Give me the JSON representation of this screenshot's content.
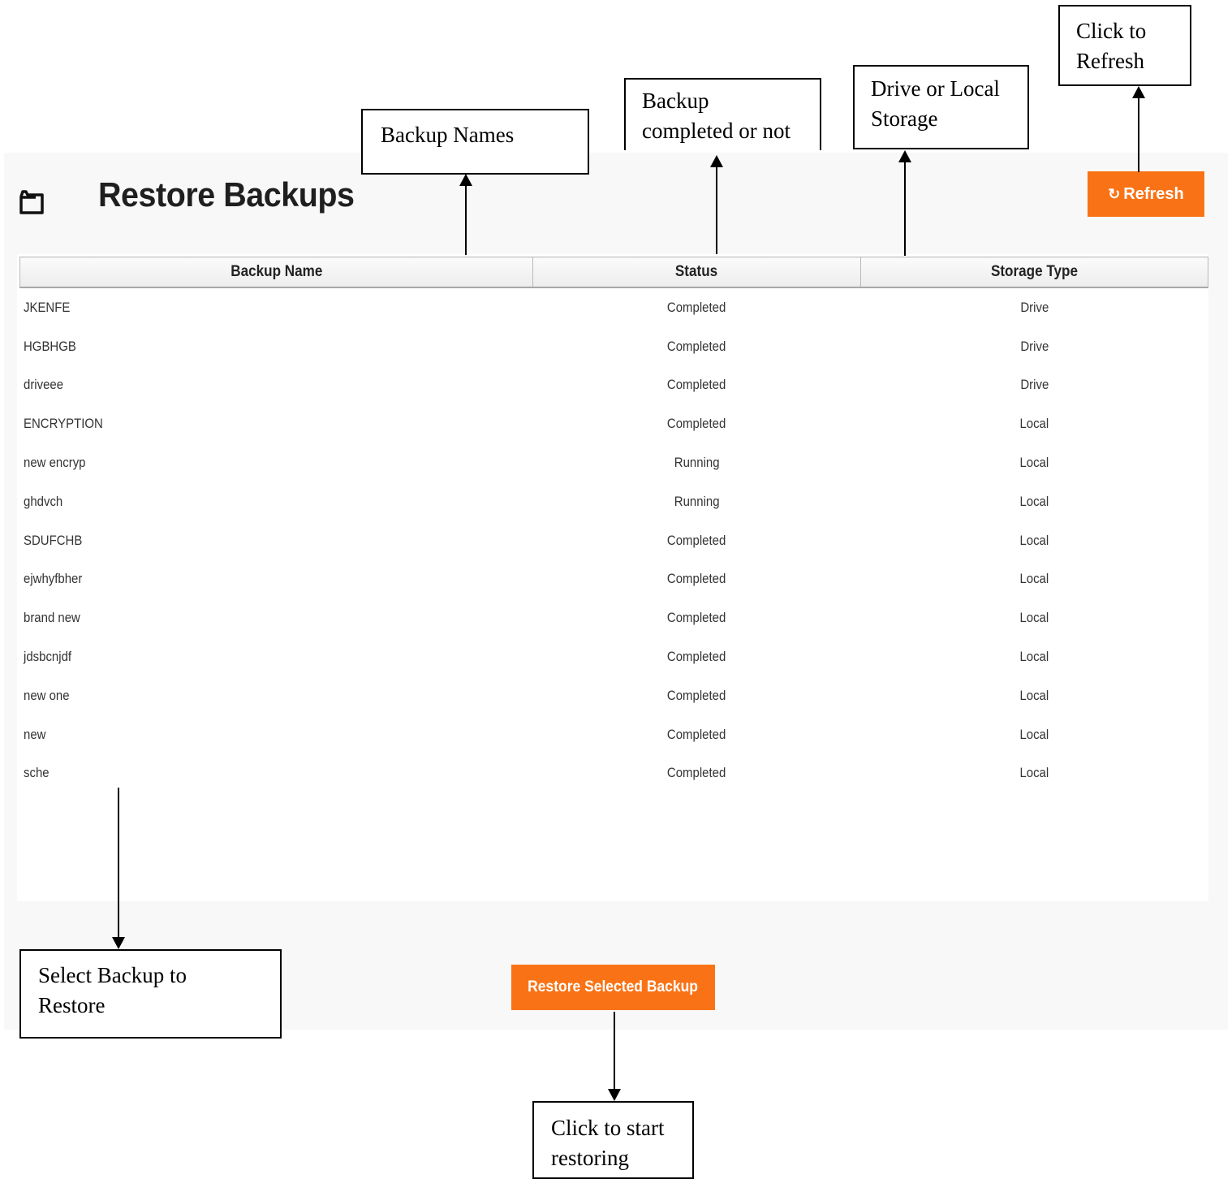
{
  "page": {
    "title": "Restore Backups",
    "icon": "folder-icon"
  },
  "toolbar": {
    "refresh_label": "Refresh",
    "refresh_icon": "refresh-icon",
    "refresh_color": "#f97316"
  },
  "table": {
    "headers": {
      "name": "Backup Name",
      "status": "Status",
      "storage": "Storage Type"
    },
    "rows": [
      {
        "name": "JKENFE",
        "status": "Completed",
        "storage": "Drive"
      },
      {
        "name": "HGBHGB",
        "status": "Completed",
        "storage": "Drive"
      },
      {
        "name": "driveee",
        "status": "Completed",
        "storage": "Drive"
      },
      {
        "name": "ENCRYPTION",
        "status": "Completed",
        "storage": "Local"
      },
      {
        "name": "new encryp",
        "status": "Running",
        "storage": "Local"
      },
      {
        "name": "ghdvch",
        "status": "Running",
        "storage": "Local"
      },
      {
        "name": "SDUFCHB",
        "status": "Completed",
        "storage": "Local"
      },
      {
        "name": "ejwhyfbher",
        "status": "Completed",
        "storage": "Local"
      },
      {
        "name": "brand new",
        "status": "Completed",
        "storage": "Local"
      },
      {
        "name": "jdsbcnjdf",
        "status": "Completed",
        "storage": "Local"
      },
      {
        "name": "new one",
        "status": "Completed",
        "storage": "Local"
      },
      {
        "name": "new",
        "status": "Completed",
        "storage": "Local"
      },
      {
        "name": "sche",
        "status": "Completed",
        "storage": "Local"
      }
    ]
  },
  "footer": {
    "restore_label": "Restore Selected Backup"
  },
  "annotations": {
    "backup_names": "Backup Names",
    "status_line1": "Backup",
    "status_line2": "completed or not",
    "storage_line1": "Drive or Local",
    "storage_line2": "Storage",
    "refresh_line1": "Click to",
    "refresh_line2": "Refresh",
    "select_line1": "Select Backup to",
    "select_line2": "Restore",
    "restore_line1": "Click to start",
    "restore_line2": "restoring"
  }
}
